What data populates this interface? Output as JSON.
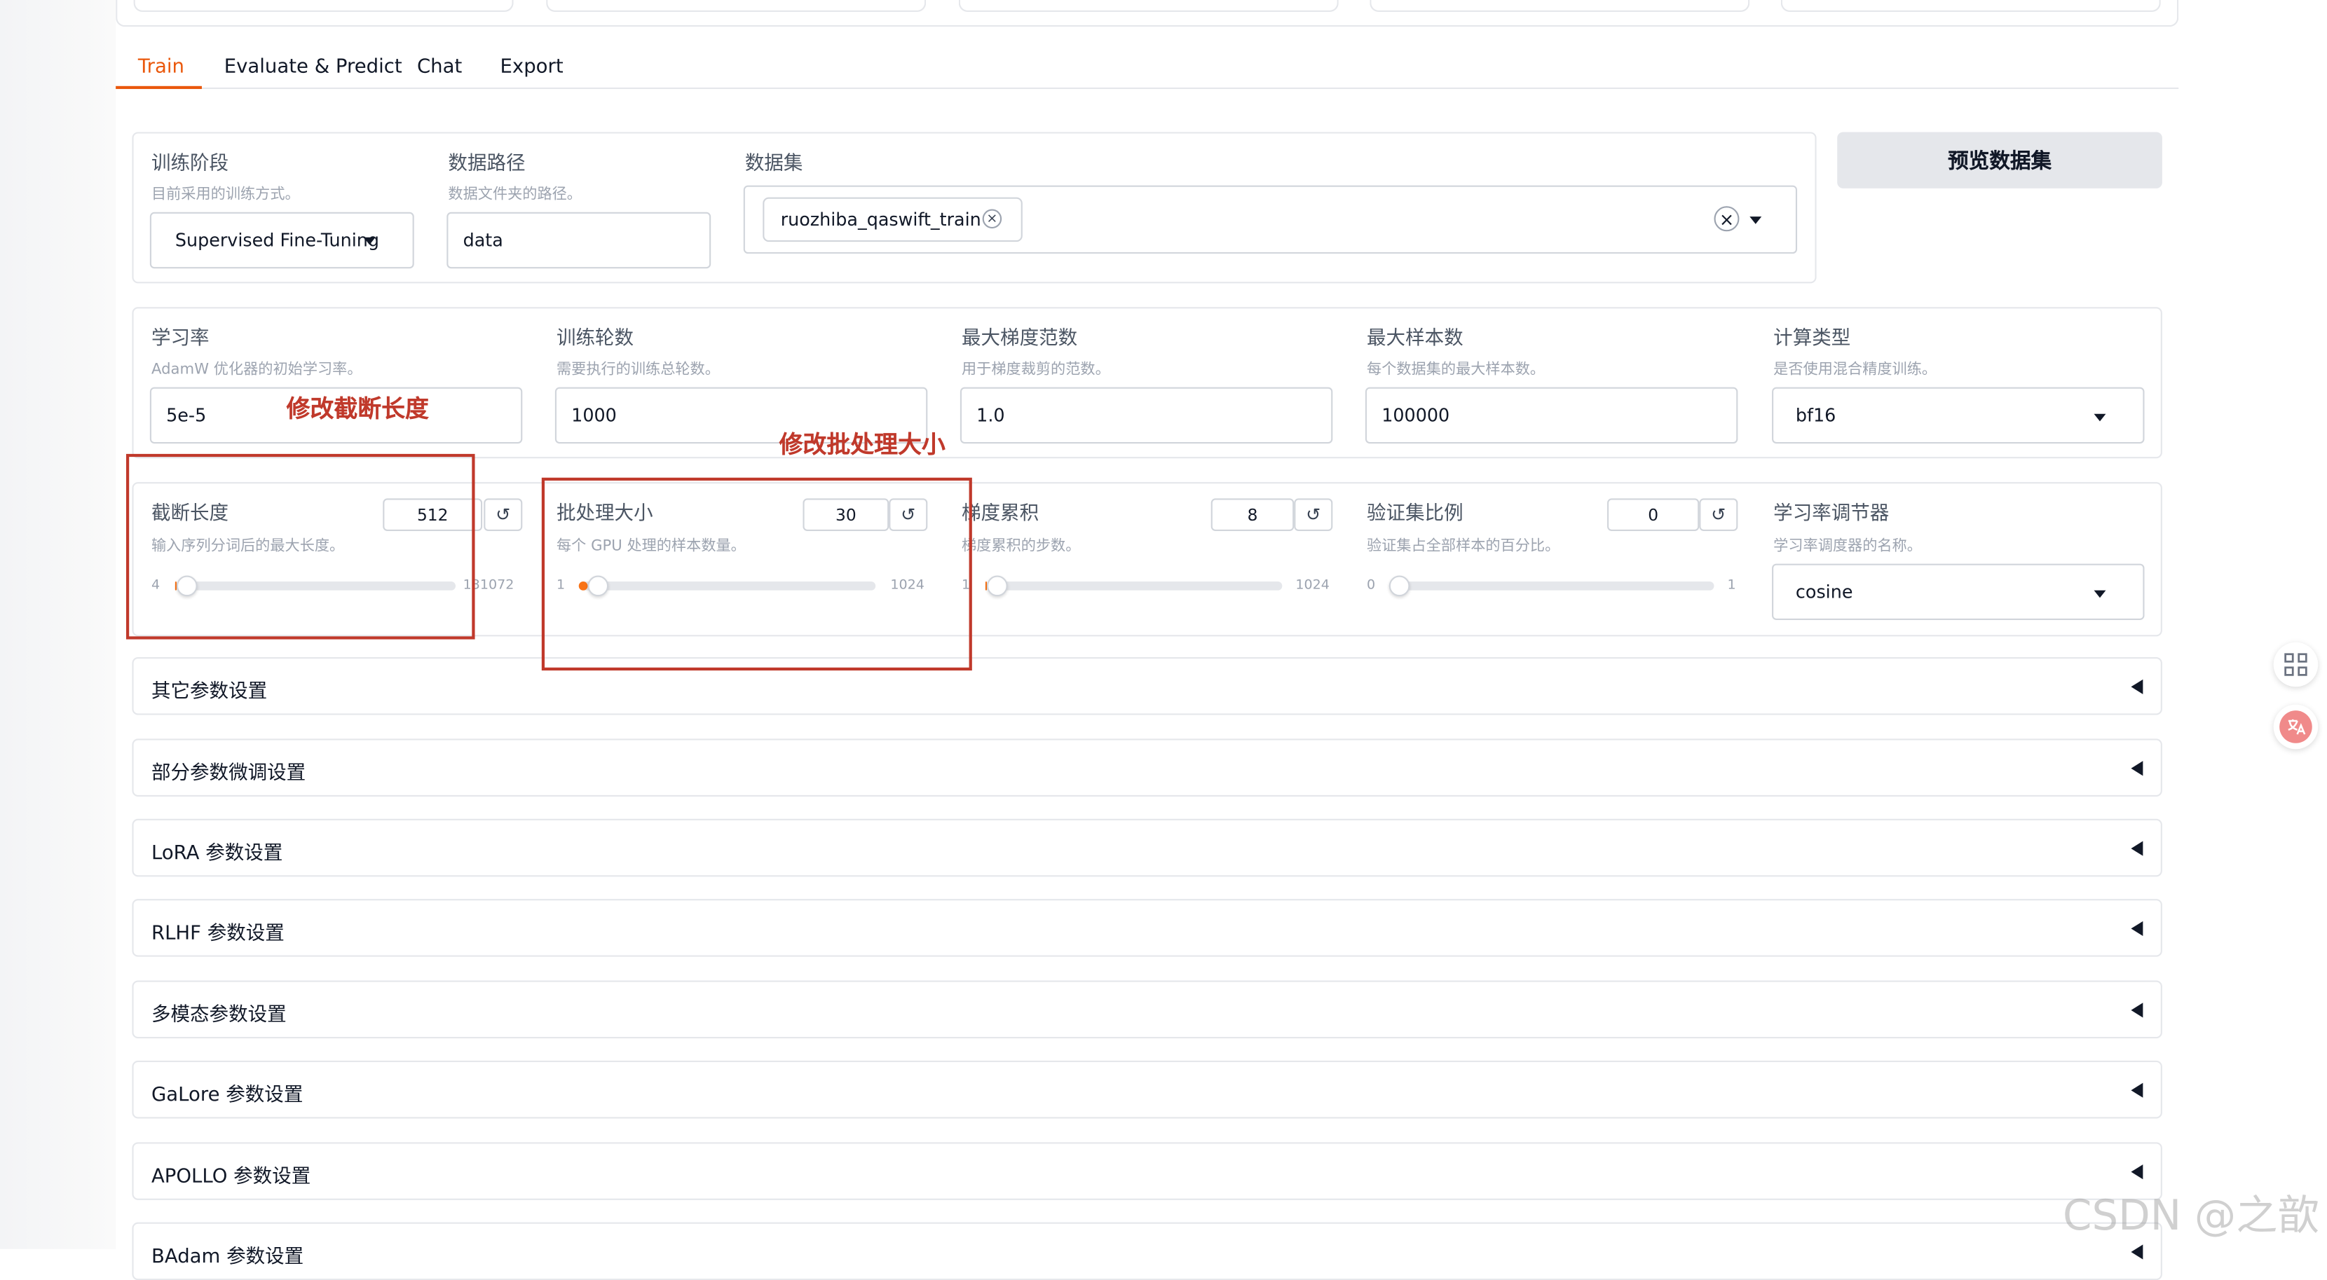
{
  "tabs": [
    {
      "label": "Train",
      "active": true
    },
    {
      "label": "Evaluate & Predict",
      "active": false
    },
    {
      "label": "Chat",
      "active": false
    },
    {
      "label": "Export",
      "active": false
    }
  ],
  "stage": {
    "label": "训练阶段",
    "info": "目前采用的训练方式。",
    "value": "Supervised Fine-Tuning"
  },
  "dataset_dir": {
    "label": "数据路径",
    "info": "数据文件夹的路径。",
    "value": "data"
  },
  "dataset": {
    "label": "数据集",
    "tag": "ruozhiba_qaswift_train",
    "tag_close": "×",
    "clear": "×"
  },
  "preview_button": "预览数据集",
  "learning_rate": {
    "label": "学习率",
    "info": "AdamW 优化器的初始学习率。",
    "value": "5e-5"
  },
  "epochs": {
    "label": "训练轮数",
    "info": "需要执行的训练总轮数。",
    "value": "1000"
  },
  "max_grad_norm": {
    "label": "最大梯度范数",
    "info": "用于梯度裁剪的范数。",
    "value": "1.0"
  },
  "max_samples": {
    "label": "最大样本数",
    "info": "每个数据集的最大样本数。",
    "value": "100000"
  },
  "compute_type": {
    "label": "计算类型",
    "info": "是否使用混合精度训练。",
    "value": "bf16"
  },
  "cutoff_len": {
    "label": "截断长度",
    "info": "输入序列分词后的最大长度。",
    "value": "512",
    "min": "4",
    "max": "131072",
    "min_value": 4,
    "max_value": 131072,
    "current": 512
  },
  "batch_size": {
    "label": "批处理大小",
    "info": "每个 GPU 处理的样本数量。",
    "value": "30",
    "min": "1",
    "max": "1024",
    "min_value": 1,
    "max_value": 1024,
    "current": 30
  },
  "grad_accum": {
    "label": "梯度累积",
    "info": "梯度累积的步数。",
    "value": "8",
    "min": "1",
    "max": "1024",
    "min_value": 1,
    "max_value": 1024,
    "current": 8
  },
  "val_size": {
    "label": "验证集比例",
    "info": "验证集占全部样本的百分比。",
    "value": "0",
    "min": "0",
    "max": "1",
    "min_value": 0,
    "max_value": 1,
    "current": 0
  },
  "lr_scheduler": {
    "label": "学习率调节器",
    "info": "学习率调度器的名称。",
    "value": "cosine"
  },
  "accordions": [
    "其它参数设置",
    "部分参数微调设置",
    "LoRA 参数设置",
    "RLHF 参数设置",
    "多模态参数设置",
    "GaLore 参数设置",
    "APOLLO 参数设置",
    "BAdam 参数设置"
  ],
  "annotations": {
    "cutoff": "修改截断长度",
    "batch": "修改批处理大小"
  },
  "reset_glyph": "↺",
  "watermark": "CSDN @之歆",
  "colors": {
    "accent": "#f97316",
    "annotation": "#c0392b",
    "tab_active": "#ea580c"
  },
  "icons": {
    "reset": "reset-icon",
    "dropdown": "chevron-down-icon",
    "accordion": "triangle-left-icon",
    "apps": "apps-icon",
    "translate": "translate-icon"
  }
}
